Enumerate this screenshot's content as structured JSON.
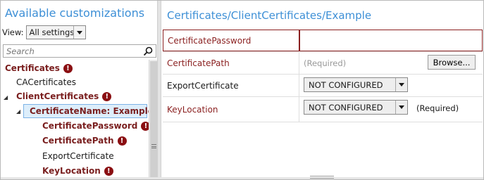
{
  "left": {
    "title": "Available customizations",
    "view_label": "View:",
    "view_value": "All settings",
    "search_placeholder": "Search",
    "tree": [
      {
        "label": "Certificates",
        "error": true
      },
      {
        "label": "CACertificates",
        "error": false
      },
      {
        "label": "ClientCertificates",
        "error": true
      },
      {
        "label": "CertificateName: Example",
        "error": true,
        "selected": true
      },
      {
        "label": "CertificatePassword",
        "error": true
      },
      {
        "label": "CertificatePath",
        "error": true
      },
      {
        "label": "ExportCertificate",
        "error": false
      },
      {
        "label": "KeyLocation",
        "error": true
      }
    ],
    "error_glyph": "!",
    "expander_glyph": "◢"
  },
  "right": {
    "title": "Certificates/ClientCertificates/Example",
    "rows": [
      {
        "label": "CertificatePassword",
        "value": ""
      },
      {
        "label": "CertificatePath",
        "value": "(Required)",
        "button": "Browse..."
      },
      {
        "label": "ExportCertificate",
        "value": "NOT CONFIGURED"
      },
      {
        "label": "KeyLocation",
        "value": "NOT CONFIGURED",
        "note": "(Required)"
      }
    ]
  },
  "colors": {
    "accent": "#3d8fd6",
    "error": "#8a0f12",
    "required_label": "#8a1f1f",
    "selection": "#ddeefb"
  }
}
